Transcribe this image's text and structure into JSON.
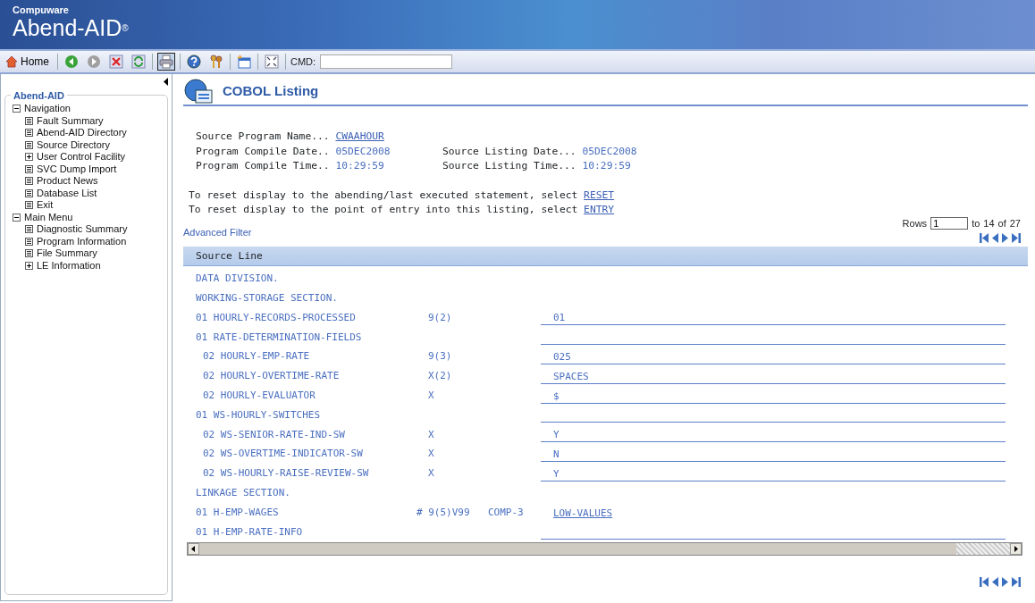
{
  "banner": {
    "vendor": "Compuware",
    "product": "Abend-AID",
    "mark": "®"
  },
  "toolbar": {
    "home_label": "Home",
    "buttons": [
      {
        "kind": "back",
        "selected": false
      },
      {
        "kind": "forward",
        "selected": false
      },
      {
        "kind": "stop",
        "selected": false
      },
      {
        "kind": "refresh",
        "selected": false
      },
      {
        "kind": "print",
        "selected": true
      },
      {
        "kind": "help",
        "selected": false
      },
      {
        "kind": "keys",
        "selected": false
      },
      {
        "kind": "new-window",
        "selected": false
      },
      {
        "kind": "fullscreen",
        "selected": false
      }
    ],
    "cmd_label": "CMD:"
  },
  "sidebar": {
    "title": "Abend-AID",
    "items": [
      {
        "label": "Navigation",
        "kind": "folder",
        "expanded": true,
        "children": [
          {
            "label": "Fault Summary",
            "kind": "leaf"
          },
          {
            "label": "Abend-AID Directory",
            "kind": "leaf"
          },
          {
            "label": "Source Directory",
            "kind": "leaf"
          },
          {
            "label": "User Control Facility",
            "kind": "folder",
            "expanded": false
          },
          {
            "label": "SVC Dump Import",
            "kind": "leaf"
          },
          {
            "label": "Product News",
            "kind": "leaf"
          },
          {
            "label": "Database List",
            "kind": "leaf"
          },
          {
            "label": "Exit",
            "kind": "leaf"
          }
        ]
      },
      {
        "label": "Main Menu",
        "kind": "folder",
        "expanded": true,
        "children": [
          {
            "label": "Diagnostic Summary",
            "kind": "leaf"
          },
          {
            "label": "Program Information",
            "kind": "leaf"
          },
          {
            "label": "File Summary",
            "kind": "leaf"
          },
          {
            "label": "LE Information",
            "kind": "folder",
            "expanded": false
          }
        ]
      }
    ]
  },
  "page": {
    "title": "COBOL Listing",
    "info": [
      {
        "label": "Source Program Name...",
        "value": "CWAAHOUR",
        "kind": "link"
      },
      {
        "label": "Program Compile Date..",
        "value": "05DEC2008",
        "kind": "text"
      },
      {
        "label": "Source Listing Date...",
        "value": "05DEC2008",
        "kind": "text"
      },
      {
        "label": "Program Compile Time..",
        "value": "10:29:59",
        "kind": "text"
      },
      {
        "label": "Source Listing Time...",
        "value": "10:29:59",
        "kind": "text"
      }
    ],
    "reset_lines": [
      {
        "text": "To reset display to the abending/last executed statement, select",
        "link": "RESET"
      },
      {
        "text": "To reset display to the point of entry into this listing, select",
        "link": "ENTRY"
      }
    ],
    "advanced_filter": "Advanced Filter",
    "rows_label": "Rows",
    "rows_from": "1",
    "rows_to_label": "to",
    "rows_to": "14",
    "rows_of_label": "of",
    "rows_total": "27"
  },
  "listing": {
    "column": "Source Line",
    "rows": [
      {
        "kind": "plain",
        "name": "DATA DIVISION."
      },
      {
        "kind": "plain",
        "name": "WORKING-STORAGE SECTION."
      },
      {
        "kind": "field",
        "name": "01 HOURLY-RECORDS-PROCESSED",
        "picture": "9(2)",
        "value": "01"
      },
      {
        "kind": "field",
        "name": "01 RATE-DETERMINATION-FIELDS",
        "children": [
          {
            "kind": "field",
            "name": "02 HOURLY-EMP-RATE",
            "picture": "9(3)",
            "value": "025"
          },
          {
            "kind": "field",
            "name": "02 HOURLY-OVERTIME-RATE",
            "picture": "X(2)",
            "value": "SPACES"
          },
          {
            "kind": "field",
            "name": "02 HOURLY-EVALUATOR",
            "picture": "X",
            "value": "$"
          }
        ]
      },
      {
        "kind": "field",
        "name": "01 WS-HOURLY-SWITCHES",
        "children": [
          {
            "kind": "field",
            "name": "02 WS-SENIOR-RATE-IND-SW",
            "picture": "X",
            "value": "Y"
          },
          {
            "kind": "field",
            "name": "02 WS-OVERTIME-INDICATOR-SW",
            "picture": "X",
            "value": "N"
          },
          {
            "kind": "field",
            "name": "02 WS-HOURLY-RAISE-REVIEW-SW",
            "picture": "X",
            "value": "Y"
          }
        ]
      },
      {
        "kind": "plain",
        "name": "LINKAGE SECTION."
      },
      {
        "kind": "link",
        "name": "01 H-EMP-WAGES",
        "picture": "# 9(5)V99",
        "usage": "COMP-3",
        "value": "LOW-VALUES"
      },
      {
        "kind": "field",
        "name": "01 H-EMP-RATE-INFO"
      }
    ]
  }
}
